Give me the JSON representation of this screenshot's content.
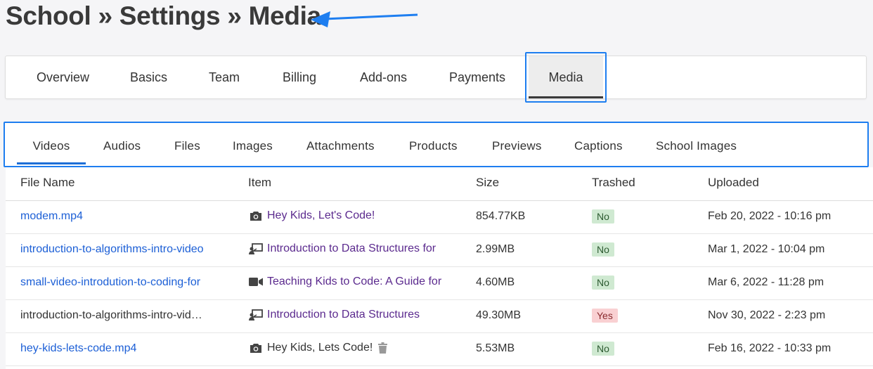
{
  "breadcrumb": "School » Settings » Media",
  "main_tabs": [
    {
      "label": "Overview"
    },
    {
      "label": "Basics"
    },
    {
      "label": "Team"
    },
    {
      "label": "Billing"
    },
    {
      "label": "Add-ons"
    },
    {
      "label": "Payments"
    },
    {
      "label": "Media",
      "active": true
    }
  ],
  "sub_tabs": [
    {
      "label": "Videos",
      "active": true
    },
    {
      "label": "Audios"
    },
    {
      "label": "Files"
    },
    {
      "label": "Images"
    },
    {
      "label": "Attachments"
    },
    {
      "label": "Products"
    },
    {
      "label": "Previews"
    },
    {
      "label": "Captions"
    },
    {
      "label": "School Images"
    }
  ],
  "table": {
    "headers": [
      "File Name",
      "Item",
      "Size",
      "Trashed",
      "Uploaded"
    ],
    "rows": [
      {
        "file": "modem.mp4",
        "file_link": true,
        "item_icon": "camera-icon",
        "item": "Hey Kids, Let's Code!",
        "item_link": true,
        "size": "854.77KB",
        "trashed": "No",
        "uploaded": "Feb 20, 2022 - 10:16 pm"
      },
      {
        "file": "introduction-to-algorithms-intro-video",
        "file_link": true,
        "item_icon": "presentation-icon",
        "item": "Introduction to Data Structures for",
        "item_link": true,
        "size": "2.99MB",
        "trashed": "No",
        "uploaded": "Mar 1, 2022 - 10:04 pm"
      },
      {
        "file": "small-video-introdution-to-coding-for",
        "file_link": true,
        "item_icon": "video-camera-icon",
        "item": "Teaching Kids to Code: A Guide for",
        "item_link": true,
        "size": "4.60MB",
        "trashed": "No",
        "uploaded": "Mar 6, 2022 - 11:28 pm"
      },
      {
        "file": "introduction-to-algorithms-intro-vid…",
        "file_link": false,
        "item_icon": "presentation-icon",
        "item": "Introduction to Data Structures",
        "item_link": true,
        "size": "49.30MB",
        "trashed": "Yes",
        "uploaded": "Nov 30, 2022 - 2:23 pm"
      },
      {
        "file": "hey-kids-lets-code.mp4",
        "file_link": true,
        "item_icon": "camera-icon",
        "item": "Hey Kids, Lets Code!",
        "item_link": false,
        "item_trash_icon": "trash-icon",
        "size": "5.53MB",
        "trashed": "No",
        "uploaded": "Feb 16, 2022 - 10:33 pm"
      }
    ]
  },
  "colors": {
    "accent_blue": "#1e7ef0",
    "link_blue": "#1c5fd6",
    "item_purple": "#5b2a8e",
    "badge_no_bg": "#cfe9d1",
    "badge_yes_bg": "#f9d0d2"
  }
}
